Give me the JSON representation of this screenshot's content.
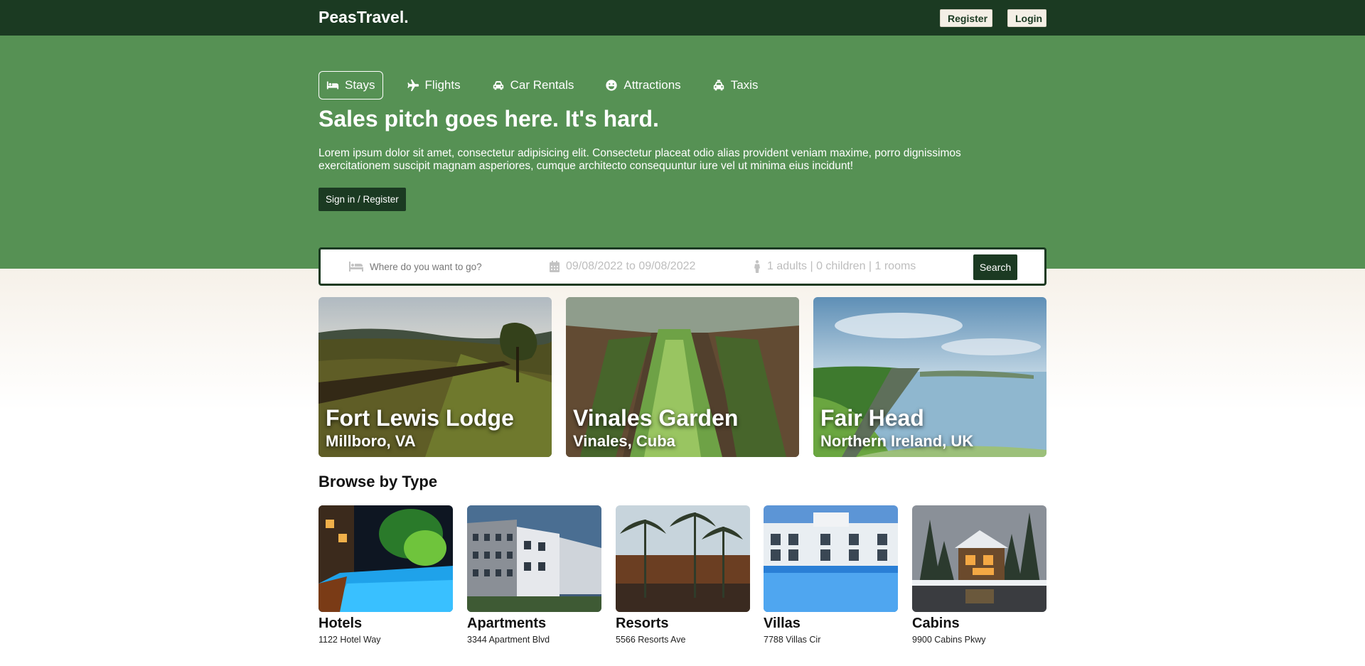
{
  "navbar": {
    "logo": "PeasTravel.",
    "register_label": "Register",
    "login_label": "Login"
  },
  "tabs": [
    {
      "label": "Stays",
      "icon": "bed-icon"
    },
    {
      "label": "Flights",
      "icon": "plane-icon"
    },
    {
      "label": "Car Rentals",
      "icon": "car-icon"
    },
    {
      "label": "Attractions",
      "icon": "smile-icon"
    },
    {
      "label": "Taxis",
      "icon": "taxi-icon"
    }
  ],
  "hero": {
    "title": "Sales pitch goes here. It's hard.",
    "description": "Lorem ipsum dolor sit amet, consectetur adipisicing elit. Consectetur placeat odio alias provident veniam maxime, porro dignissimos exercitationem suscipit magnam asperiores, cumque architecto consequuntur iure vel ut minima eius incidunt!",
    "signin_label": "Sign in / Register"
  },
  "search": {
    "destination_placeholder": "Where do you want to go?",
    "dates": "09/08/2022 to 09/08/2022",
    "guests": "1 adults | 0 children | 1 rooms",
    "search_label": "Search"
  },
  "featured": [
    {
      "name": "Fort Lewis Lodge",
      "location": "Millboro, VA"
    },
    {
      "name": "Vinales Garden",
      "location": "Vinales, Cuba"
    },
    {
      "name": "Fair Head",
      "location": "Northern Ireland, UK"
    }
  ],
  "browse": {
    "title": "Browse by Type",
    "types": [
      {
        "name": "Hotels",
        "address": "1122 Hotel Way"
      },
      {
        "name": "Apartments",
        "address": "3344 Apartment Blvd"
      },
      {
        "name": "Resorts",
        "address": "5566 Resorts Ave"
      },
      {
        "name": "Villas",
        "address": "7788 Villas Cir"
      },
      {
        "name": "Cabins",
        "address": "9900 Cabins Pkwy"
      }
    ]
  },
  "colors": {
    "navbar": "#1b3a22",
    "hero": "#569154",
    "button_dark": "#1b3a22",
    "nav_button_bg": "#f4efe6"
  }
}
